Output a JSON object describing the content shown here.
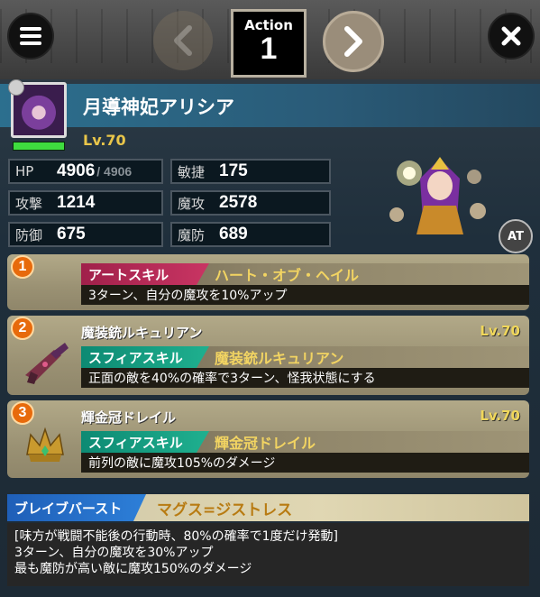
{
  "header": {
    "action_label": "Action",
    "action_number": "1"
  },
  "unit": {
    "name": "月導神妃アリシア",
    "level": "Lv.70",
    "hp_fraction": 1.0
  },
  "stats": {
    "hp_label": "HP",
    "hp_value": "4906",
    "hp_max": "/ 4906",
    "atk_label": "攻撃",
    "atk_value": "1214",
    "def_label": "防御",
    "def_value": "675",
    "agi_label": "敏捷",
    "agi_value": "175",
    "mag_label": "魔攻",
    "mag_value": "2578",
    "mdef_label": "魔防",
    "mdef_value": "689"
  },
  "at_badge": "AT",
  "skills": [
    {
      "number": "1",
      "tag": "アートスキル",
      "skill_name": "ハート・オブ・ヘイル",
      "description": "3ターン、自分の魔攻を10%アップ"
    },
    {
      "number": "2",
      "title": "魔装銃ルキュリアン",
      "level": "Lv.70",
      "tag": "スフィアスキル",
      "skill_name": "魔装銃ルキュリアン",
      "description": "正面の敵を40%の確率で3ターン、怪我状態にする"
    },
    {
      "number": "3",
      "title": "輝金冠ドレイル",
      "level": "Lv.70",
      "tag": "スフィアスキル",
      "skill_name": "輝金冠ドレイル",
      "description": "前列の敵に魔攻105%のダメージ"
    }
  ],
  "brave_burst": {
    "tag": "ブレイブバースト",
    "name": "マグス=ジストレス",
    "lines": [
      "[味方が戦闘不能後の行動時、80%の確率で1度だけ発動]",
      "3ターン、自分の魔攻を30%アップ",
      "最も魔防が高い敵に魔攻150%のダメージ"
    ]
  },
  "colors": {
    "art_tag": "#c93563",
    "sphere_tag": "#1fb08f",
    "brave_tag": "#2d7fd8",
    "level_gold": "#e9c64a",
    "number_badge": "#e76a0c"
  },
  "icons": {
    "menu": "menu-icon",
    "close": "close-icon",
    "prev": "chevron-left-icon",
    "next": "chevron-right-icon"
  }
}
